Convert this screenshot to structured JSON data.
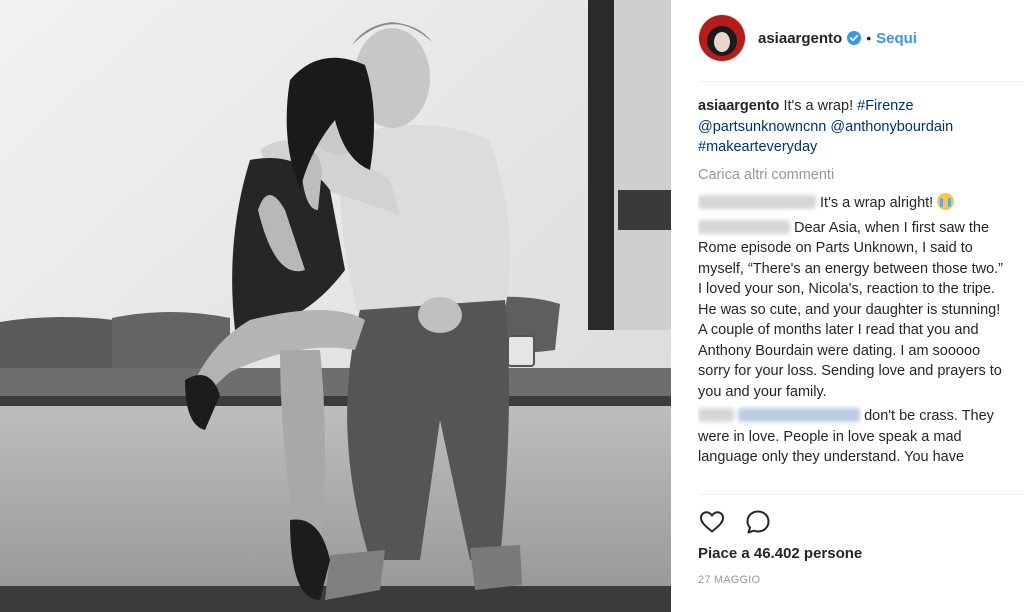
{
  "post": {
    "username": "asiaargento",
    "follow_label": "Sequi",
    "separator": "•",
    "caption": {
      "username": "asiaargento",
      "text": "It's a wrap!",
      "tags": [
        "#Firenze",
        "@partsunknowncnn",
        "@anthonybourdain",
        "#makearteveryday"
      ]
    },
    "load_more_label": "Carica altri commenti",
    "comments": [
      {
        "text": "It's a wrap alright!",
        "emoji": "crying-face-icon"
      },
      {
        "text": "Dear Asia, when I first saw the Rome episode on Parts Unknown, I said to myself, “There's an energy between those two.” I loved your son, Nicola's, reaction to the tripe. He was so cute, and your daughter is stunning! A couple of months later I read that you and Anthony Bourdain were dating. I am sooooo sorry for your loss. Sending love and prayers to you and your family."
      },
      {
        "text": "don't be crass. They were in love. People in love speak a mad language only they understand. You have"
      }
    ],
    "likes_label": "Piace a 46.402 persone",
    "date_label": "27 MAGGIO"
  },
  "icons": {
    "verified": "verified-badge-icon",
    "like": "heart-icon",
    "comment": "comment-bubble-icon"
  },
  "colors": {
    "link": "#3897f0",
    "hashtag": "#003569",
    "muted": "#999999",
    "text": "#262626"
  }
}
